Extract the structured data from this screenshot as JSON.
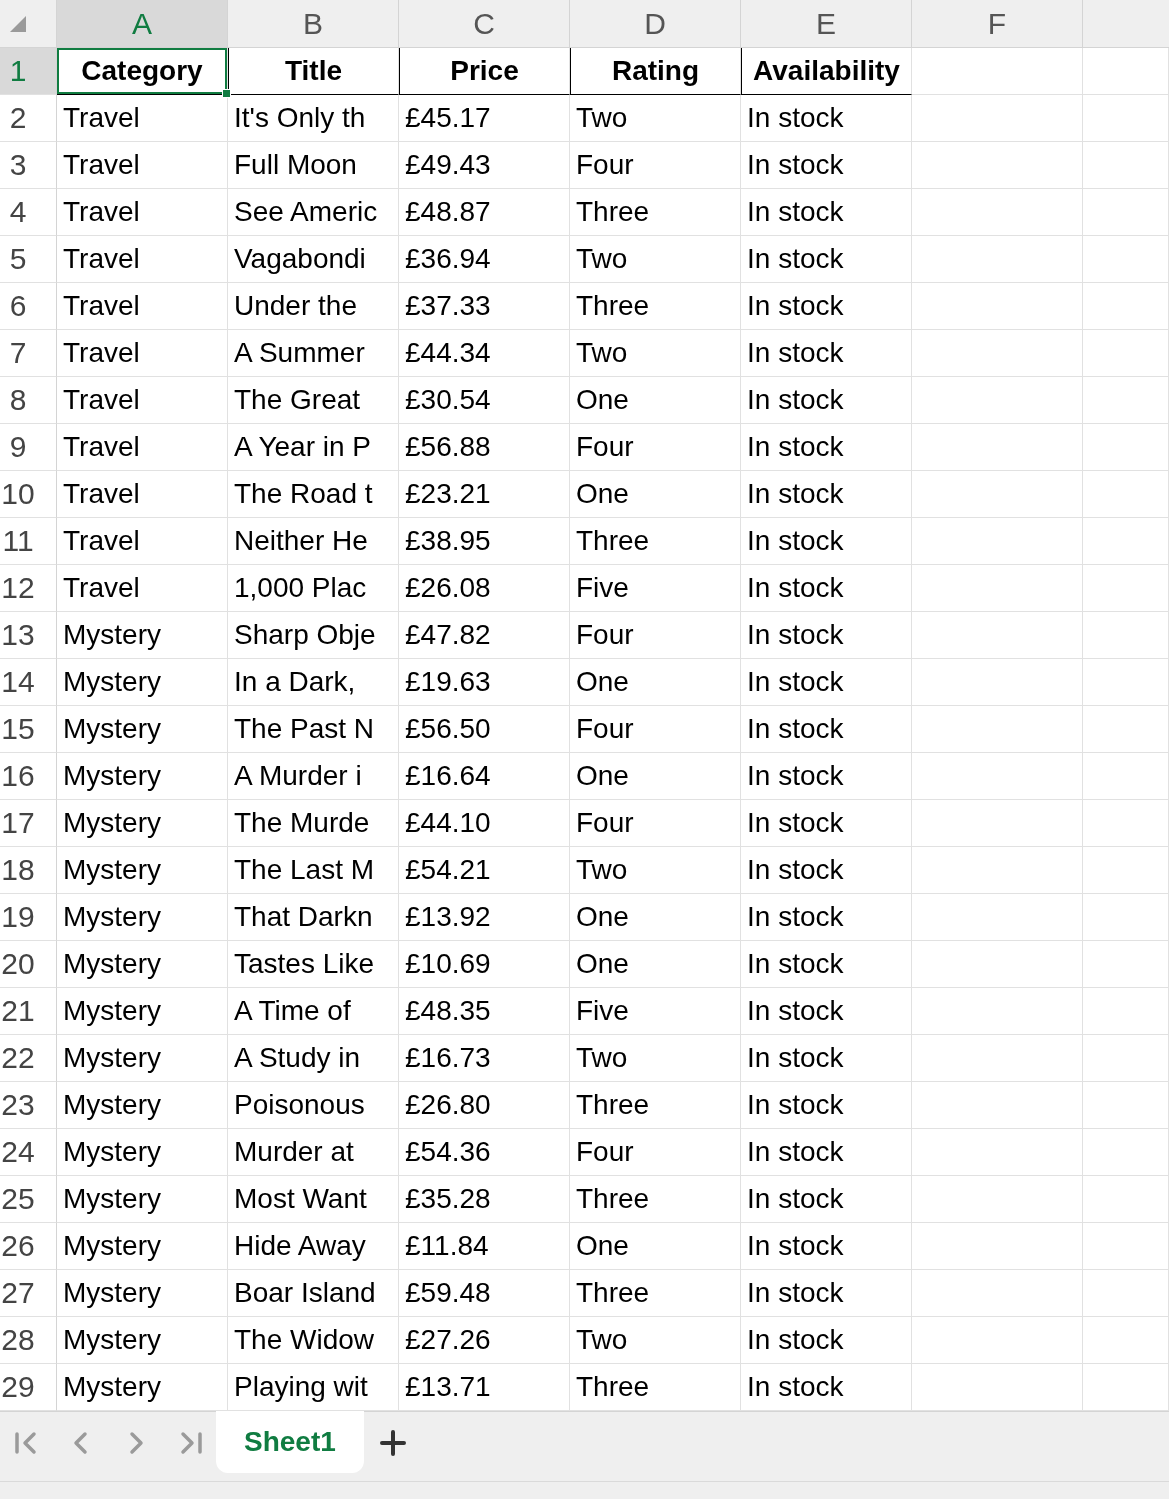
{
  "sheet": {
    "columns": [
      {
        "label": "A",
        "selected": true
      },
      {
        "label": "B",
        "selected": false
      },
      {
        "label": "C",
        "selected": false
      },
      {
        "label": "D",
        "selected": false
      },
      {
        "label": "E",
        "selected": false
      },
      {
        "label": "F",
        "selected": false
      }
    ],
    "header_row": {
      "number": "1",
      "selected": true,
      "cells": [
        "Category",
        "Title",
        "Price",
        "Rating",
        "Availability"
      ]
    },
    "rows": [
      {
        "number": "2",
        "selected": false,
        "cells": [
          "Travel",
          "It's Only th",
          "£45.17",
          "Two",
          "In stock"
        ]
      },
      {
        "number": "3",
        "selected": false,
        "cells": [
          "Travel",
          "Full Moon",
          "£49.43",
          "Four",
          "In stock"
        ]
      },
      {
        "number": "4",
        "selected": false,
        "cells": [
          "Travel",
          "See Americ",
          "£48.87",
          "Three",
          "In stock"
        ]
      },
      {
        "number": "5",
        "selected": false,
        "cells": [
          "Travel",
          "Vagabondi",
          "£36.94",
          "Two",
          "In stock"
        ]
      },
      {
        "number": "6",
        "selected": false,
        "cells": [
          "Travel",
          "Under the",
          "£37.33",
          "Three",
          "In stock"
        ]
      },
      {
        "number": "7",
        "selected": false,
        "cells": [
          "Travel",
          "A Summer",
          "£44.34",
          "Two",
          "In stock"
        ]
      },
      {
        "number": "8",
        "selected": false,
        "cells": [
          "Travel",
          "The Great",
          "£30.54",
          "One",
          "In stock"
        ]
      },
      {
        "number": "9",
        "selected": false,
        "cells": [
          "Travel",
          "A Year in P",
          "£56.88",
          "Four",
          "In stock"
        ]
      },
      {
        "number": "10",
        "selected": false,
        "cells": [
          "Travel",
          "The Road t",
          "£23.21",
          "One",
          "In stock"
        ]
      },
      {
        "number": "11",
        "selected": false,
        "cells": [
          "Travel",
          "Neither He",
          "£38.95",
          "Three",
          "In stock"
        ]
      },
      {
        "number": "12",
        "selected": false,
        "cells": [
          "Travel",
          "1,000 Plac",
          "£26.08",
          "Five",
          "In stock"
        ]
      },
      {
        "number": "13",
        "selected": false,
        "cells": [
          "Mystery",
          "Sharp Obje",
          "£47.82",
          "Four",
          "In stock"
        ]
      },
      {
        "number": "14",
        "selected": false,
        "cells": [
          "Mystery",
          "In a Dark,",
          "£19.63",
          "One",
          "In stock"
        ]
      },
      {
        "number": "15",
        "selected": false,
        "cells": [
          "Mystery",
          "The Past N",
          "£56.50",
          "Four",
          "In stock"
        ]
      },
      {
        "number": "16",
        "selected": false,
        "cells": [
          "Mystery",
          "A Murder i",
          "£16.64",
          "One",
          "In stock"
        ]
      },
      {
        "number": "17",
        "selected": false,
        "cells": [
          "Mystery",
          "The Murde",
          "£44.10",
          "Four",
          "In stock"
        ]
      },
      {
        "number": "18",
        "selected": false,
        "cells": [
          "Mystery",
          "The Last M",
          "£54.21",
          "Two",
          "In stock"
        ]
      },
      {
        "number": "19",
        "selected": false,
        "cells": [
          "Mystery",
          "That Darkn",
          "£13.92",
          "One",
          "In stock"
        ]
      },
      {
        "number": "20",
        "selected": false,
        "cells": [
          "Mystery",
          "Tastes Like",
          "£10.69",
          "One",
          "In stock"
        ]
      },
      {
        "number": "21",
        "selected": false,
        "cells": [
          "Mystery",
          "A Time of",
          "£48.35",
          "Five",
          "In stock"
        ]
      },
      {
        "number": "22",
        "selected": false,
        "cells": [
          "Mystery",
          "A Study in",
          "£16.73",
          "Two",
          "In stock"
        ]
      },
      {
        "number": "23",
        "selected": false,
        "cells": [
          "Mystery",
          "Poisonous",
          "£26.80",
          "Three",
          "In stock"
        ]
      },
      {
        "number": "24",
        "selected": false,
        "cells": [
          "Mystery",
          "Murder at",
          "£54.36",
          "Four",
          "In stock"
        ]
      },
      {
        "number": "25",
        "selected": false,
        "cells": [
          "Mystery",
          "Most Want",
          "£35.28",
          "Three",
          "In stock"
        ]
      },
      {
        "number": "26",
        "selected": false,
        "cells": [
          "Mystery",
          "Hide Away",
          "£11.84",
          "One",
          "In stock"
        ]
      },
      {
        "number": "27",
        "selected": false,
        "cells": [
          "Mystery",
          "Boar Island",
          "£59.48",
          "Three",
          "In stock"
        ]
      },
      {
        "number": "28",
        "selected": false,
        "cells": [
          "Mystery",
          "The Widow",
          "£27.26",
          "Two",
          "In stock"
        ]
      },
      {
        "number": "29",
        "selected": false,
        "cells": [
          "Mystery",
          "Playing wit",
          "£13.71",
          "Three",
          "In stock"
        ]
      }
    ]
  },
  "sheet_tabs": {
    "tabs": [
      {
        "label": "Sheet1",
        "selected": true
      }
    ]
  }
}
